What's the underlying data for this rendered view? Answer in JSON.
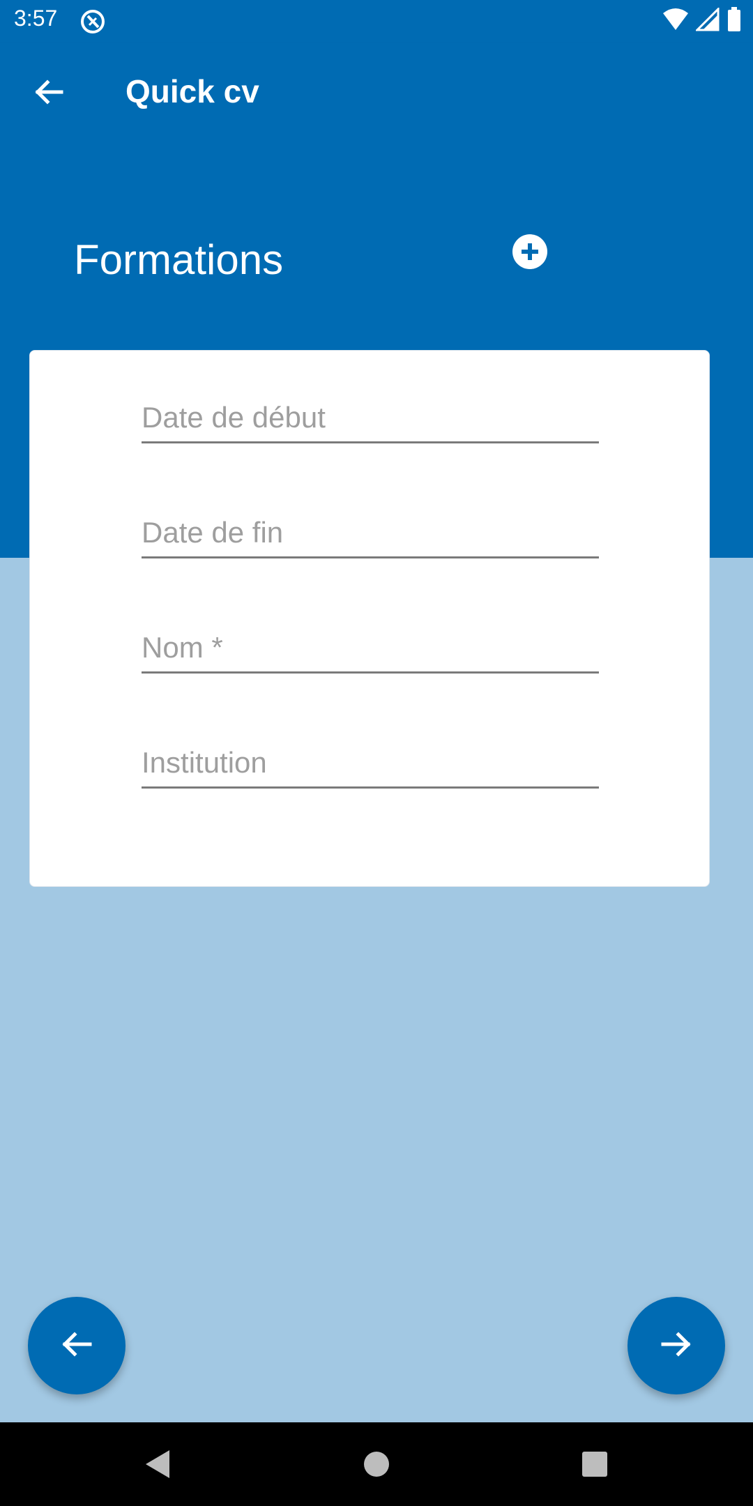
{
  "status": {
    "time": "3:57",
    "icons": [
      "app-notification-icon",
      "wifi-icon",
      "cell-signal-icon",
      "battery-icon"
    ]
  },
  "appbar": {
    "title": "Quick cv",
    "back_icon": "arrow-back-icon"
  },
  "section": {
    "title": "Formations",
    "add_icon": "add-circle-icon"
  },
  "form": {
    "fields": [
      {
        "placeholder": "Date de début",
        "value": ""
      },
      {
        "placeholder": "Date de fin",
        "value": ""
      },
      {
        "placeholder": "Nom *",
        "value": ""
      },
      {
        "placeholder": "Institution",
        "value": ""
      }
    ]
  },
  "fabs": {
    "previous_icon": "arrow-back-icon",
    "next_icon": "arrow-forward-icon"
  },
  "navigation": {
    "icons": [
      "nav-back-icon",
      "nav-home-icon",
      "nav-recents-icon"
    ]
  },
  "colors": {
    "primary": "#006bb3",
    "background": "#a2c8e3",
    "card": "#ffffff"
  }
}
